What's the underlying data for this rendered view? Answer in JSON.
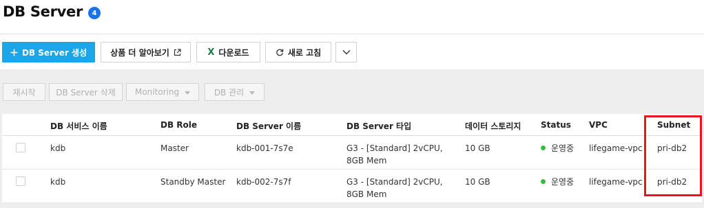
{
  "header": {
    "title": "DB Server",
    "count": "4"
  },
  "toolbar": {
    "create_label": "DB Server 생성",
    "learn_more_label": "상품 더 알아보기",
    "download_label": "다운로드",
    "refresh_label": "새로 고침"
  },
  "actions": {
    "restart_label": "재시작",
    "delete_label": "DB Server 삭제",
    "monitoring_label": "Monitoring",
    "manage_label": "DB 관리"
  },
  "table": {
    "columns": [
      "DB 서비스 이름",
      "DB Role",
      "DB Server 이름",
      "DB Server 타입",
      "데이터 스토리지",
      "Status",
      "VPC",
      "Subnet"
    ],
    "rows": [
      {
        "service": "kdb",
        "role": "Master",
        "server_name": "kdb-001-7s7e",
        "type": "G3 - [Standard] 2vCPU, 8GB Mem",
        "storage": "10 GB",
        "status": "운영중",
        "vpc": "lifegame-vpc",
        "subnet": "pri-db2"
      },
      {
        "service": "kdb",
        "role": "Standby Master",
        "server_name": "kdb-002-7s7f",
        "type": "G3 - [Standard] 2vCPU, 8GB Mem",
        "storage": "10 GB",
        "status": "운영중",
        "vpc": "lifegame-vpc",
        "subnet": "pri-db2"
      }
    ]
  },
  "colors": {
    "primary": "#1ba6e9",
    "badge": "#1a73e8",
    "status_ok": "#2fbf3a",
    "highlight": "#e8151b",
    "excel": "#1d7d45"
  },
  "icons": {
    "create": "plus-icon",
    "learn_more": "external-link-icon",
    "download": "excel-icon",
    "refresh": "refresh-icon",
    "more": "chevron-down-icon"
  }
}
